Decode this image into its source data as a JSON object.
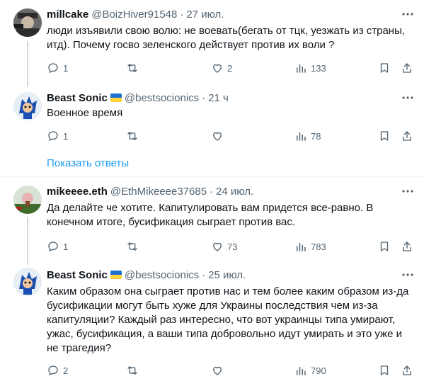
{
  "tweets": [
    {
      "name": "millcake",
      "handle": "@BoizHiver91548",
      "dot": "·",
      "time": "27 июл.",
      "text": "люди изъявили свою волю: не воевать(бегать от тцк, уезжать из страны, итд). Почему госво зеленского действует против их воли ?",
      "replies": "1",
      "retweets": "",
      "likes": "2",
      "views": "133",
      "verified_flag": false
    },
    {
      "name": "Beast Sonic",
      "handle": "@bestsocionics",
      "dot": "·",
      "time": "21 ч",
      "text": "Военное время",
      "replies": "1",
      "retweets": "",
      "likes": "",
      "views": "78",
      "verified_flag": true
    },
    {
      "name": "mikeeee.eth",
      "handle": "@EthMikeeee37685",
      "dot": "·",
      "time": "24 июл.",
      "text": "Да делайте че хотите. Капитулировать вам придется все-равно. В конечном итоге, бусификация сыграет против вас.",
      "replies": "1",
      "retweets": "",
      "likes": "73",
      "views": "783",
      "verified_flag": false
    },
    {
      "name": "Beast Sonic",
      "handle": "@bestsocionics",
      "dot": "·",
      "time": "25 июл.",
      "text": "Каким образом она сыграет против нас и тем более каким образом из-да бусификации могут быть хуже для Украины последствия чем из-за капитуляции? Каждый раз интересно, что вот украинцы типа умирают, ужас, бусификация, а ваши типа добровольно идут умирать и это уже и не трагедия?",
      "replies": "2",
      "retweets": "",
      "likes": "",
      "views": "790",
      "verified_flag": true
    }
  ],
  "show_replies_label": "Показать ответы",
  "colors": {
    "text": "#0f1419",
    "secondary": "#536471",
    "link": "#1d9bf0",
    "divider": "#eff3f4",
    "flag_blue": "#1d6fd1",
    "flag_yellow": "#ffd43b"
  },
  "icons": [
    "reply-icon",
    "retweet-icon",
    "like-icon",
    "views-icon",
    "bookmark-icon",
    "share-icon",
    "more-icon"
  ]
}
